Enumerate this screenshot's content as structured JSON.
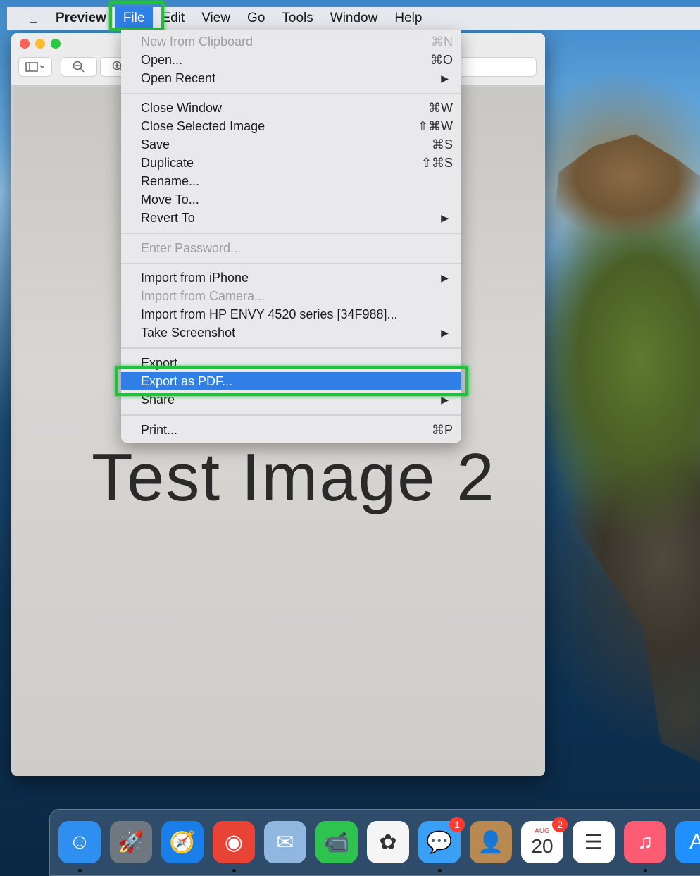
{
  "menubar": {
    "apple": "",
    "app": "Preview",
    "items": [
      "File",
      "Edit",
      "View",
      "Go",
      "Tools",
      "Window",
      "Help"
    ]
  },
  "window": {
    "page_text": "Test Image 2"
  },
  "file_menu": {
    "items": [
      {
        "label": "New from Clipboard",
        "shortcut": "⌘N",
        "disabled": true
      },
      {
        "label": "Open...",
        "shortcut": "⌘O"
      },
      {
        "label": "Open Recent",
        "submenu": true
      },
      {
        "label": "Close Window",
        "shortcut": "⌘W"
      },
      {
        "label": "Close Selected Image",
        "shortcut": "⇧⌘W"
      },
      {
        "label": "Save",
        "shortcut": "⌘S"
      },
      {
        "label": "Duplicate",
        "shortcut": "⇧⌘S"
      },
      {
        "label": "Rename..."
      },
      {
        "label": "Move To..."
      },
      {
        "label": "Revert To",
        "submenu": true
      },
      {
        "label": "Enter Password...",
        "disabled": true
      },
      {
        "label": "Import from iPhone",
        "submenu": true
      },
      {
        "label": "Import from Camera...",
        "disabled": true
      },
      {
        "label": "Import from HP ENVY 4520 series [34F988]..."
      },
      {
        "label": "Take Screenshot",
        "submenu": true
      },
      {
        "label": "Export..."
      },
      {
        "label": "Export as PDF...",
        "selected": true
      },
      {
        "label": "Share",
        "submenu": true
      },
      {
        "label": "Print...",
        "shortcut": "⌘P"
      }
    ]
  },
  "dock": {
    "icons": [
      {
        "name": "finder-icon",
        "glyph": "☺",
        "color": "#2f8ff0"
      },
      {
        "name": "launchpad-icon",
        "glyph": "🚀",
        "color": "#6f7780"
      },
      {
        "name": "safari-icon",
        "glyph": "🧭",
        "color": "#1a7ee8"
      },
      {
        "name": "chrome-icon",
        "glyph": "◉",
        "color": "#e94335"
      },
      {
        "name": "mail-icon",
        "glyph": "✉",
        "color": "#8fb7df"
      },
      {
        "name": "facetime-icon",
        "glyph": "📹",
        "color": "#2ec24f"
      },
      {
        "name": "photos-icon",
        "glyph": "✿",
        "color": "#f5f5f5"
      },
      {
        "name": "messages-icon",
        "glyph": "💬",
        "color": "#3aa0f5",
        "badge": "1"
      },
      {
        "name": "contacts-icon",
        "glyph": "👤",
        "color": "#b88a52"
      },
      {
        "name": "calendar-icon",
        "glyph": "20",
        "color": "#ffffff",
        "badge": "2",
        "sub": "AUG"
      },
      {
        "name": "reminders-icon",
        "glyph": "☰",
        "color": "#ffffff"
      },
      {
        "name": "music-icon",
        "glyph": "♫",
        "color": "#fb5c74"
      },
      {
        "name": "app-store-icon",
        "glyph": "A",
        "color": "#1e90ff"
      }
    ]
  }
}
